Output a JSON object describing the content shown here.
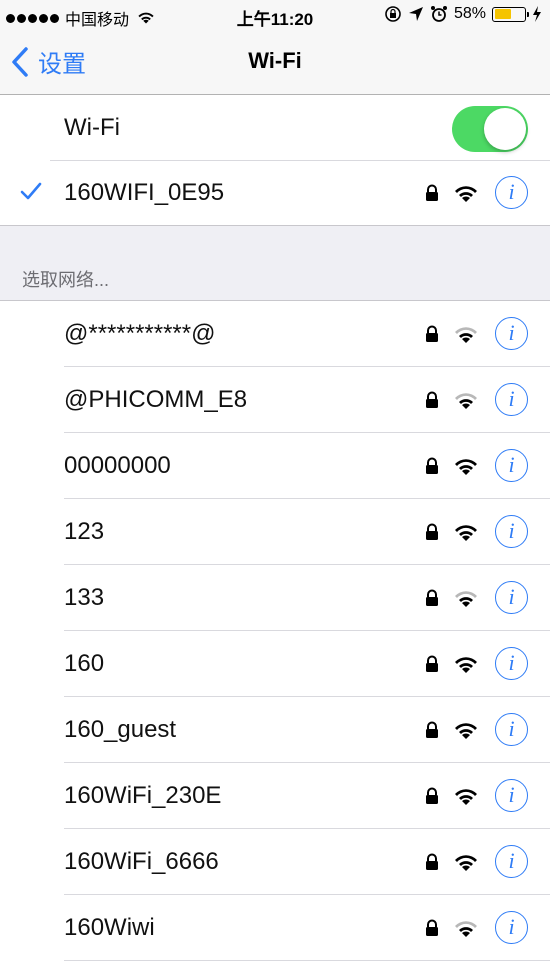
{
  "status_bar": {
    "carrier": "中国移动",
    "time": "上午11:20",
    "battery_percent": "58%",
    "battery_level": 0.58
  },
  "nav": {
    "back_label": "设置",
    "title": "Wi-Fi"
  },
  "wifi_toggle": {
    "label": "Wi-Fi",
    "on": true
  },
  "connected_network": {
    "name": "160WIFI_0E95",
    "secured": true,
    "signal": "strong"
  },
  "section_header": "选取网络...",
  "networks": [
    {
      "name": "@***********@",
      "secured": true,
      "signal": "weak"
    },
    {
      "name": "@PHICOMM_E8",
      "secured": true,
      "signal": "weak"
    },
    {
      "name": "00000000",
      "secured": true,
      "signal": "strong"
    },
    {
      "name": "123",
      "secured": true,
      "signal": "strong"
    },
    {
      "name": "133",
      "secured": true,
      "signal": "weak"
    },
    {
      "name": "160",
      "secured": true,
      "signal": "strong"
    },
    {
      "name": "160_guest",
      "secured": true,
      "signal": "strong"
    },
    {
      "name": "160WiFi_230E",
      "secured": true,
      "signal": "strong"
    },
    {
      "name": "160WiFi_6666",
      "secured": true,
      "signal": "strong"
    },
    {
      "name": "160Wiwi",
      "secured": true,
      "signal": "weak"
    }
  ],
  "icons": {
    "info": "i",
    "colors": {
      "accent": "#2f7cf6",
      "toggle_on": "#4cd964",
      "battery": "#f5c400"
    }
  }
}
